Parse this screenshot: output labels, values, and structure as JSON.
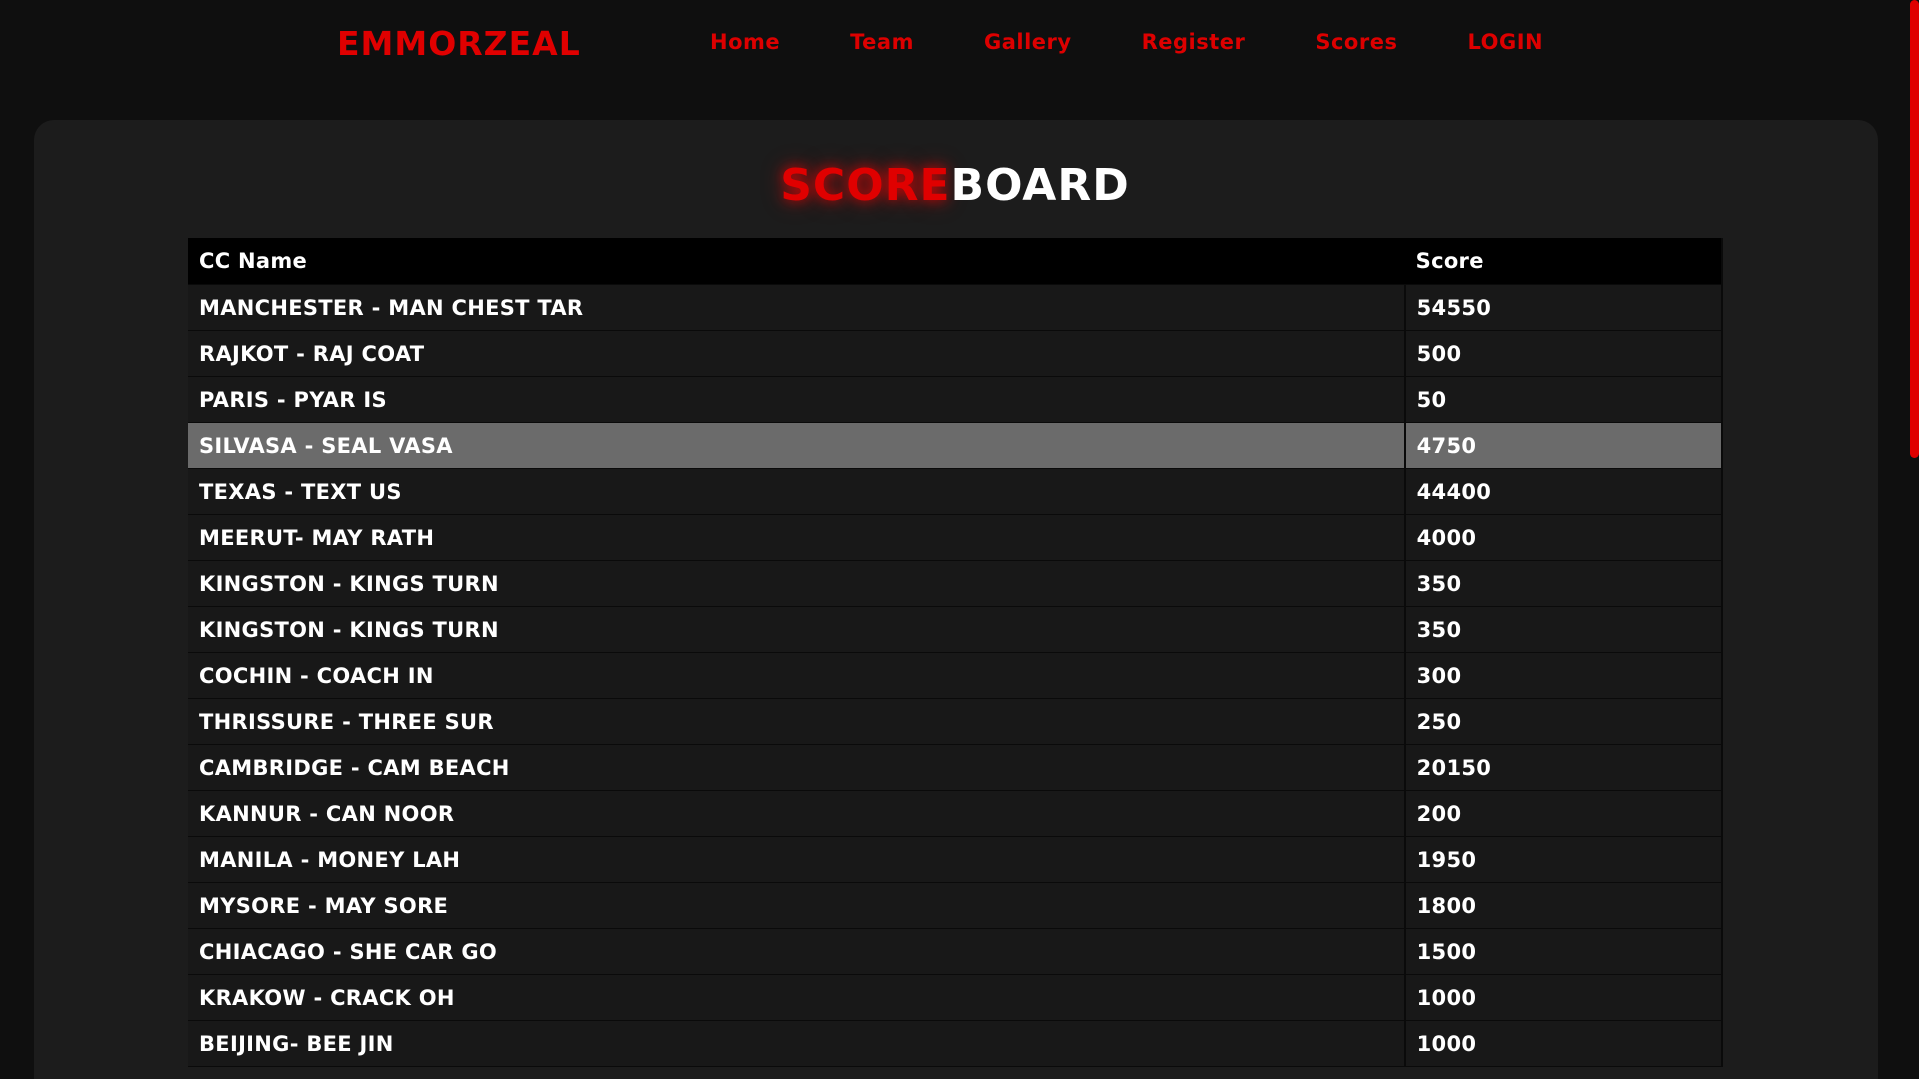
{
  "nav": {
    "brand": "EMMORZEAL",
    "links": [
      "Home",
      "Team",
      "Gallery",
      "Register",
      "Scores",
      "LOGIN"
    ]
  },
  "heading": {
    "accent": "SCORE",
    "rest": "BOARD"
  },
  "table": {
    "headers": [
      "CC Name",
      "Score"
    ],
    "rows": [
      {
        "name": "MANCHESTER - MAN CHEST TAR",
        "score": "54550"
      },
      {
        "name": "RAJKOT - RAJ COAT",
        "score": "500"
      },
      {
        "name": "PARIS - PYAR IS",
        "score": "50"
      },
      {
        "name": "SILVASA - SEAL VASA",
        "score": "4750"
      },
      {
        "name": "TEXAS - TEXT US",
        "score": "44400"
      },
      {
        "name": "MEERUT- MAY RATH",
        "score": "4000"
      },
      {
        "name": "KINGSTON - KINGS TURN",
        "score": "350"
      },
      {
        "name": "KINGSTON - KINGS TURN",
        "score": "350"
      },
      {
        "name": "COCHIN - COACH IN",
        "score": "300"
      },
      {
        "name": "THRISSURE - THREE SUR",
        "score": "250"
      },
      {
        "name": "CAMBRIDGE - CAM BEACH",
        "score": "20150"
      },
      {
        "name": "KANNUR - CAN NOOR",
        "score": "200"
      },
      {
        "name": "MANILA - MONEY LAH",
        "score": "1950"
      },
      {
        "name": "MYSORE - MAY SORE",
        "score": "1800"
      },
      {
        "name": "CHIACAGO - SHE CAR GO",
        "score": "1500"
      },
      {
        "name": "KRAKOW - CRACK OH",
        "score": "1000"
      },
      {
        "name": "BEIJING- BEE JIN",
        "score": "1000"
      }
    ]
  },
  "colors": {
    "accent": "#e00000",
    "background": "#0f0f0f",
    "panel": "#1c1c1c",
    "row": "#181818",
    "highlight_row": "#6b6b6b"
  }
}
